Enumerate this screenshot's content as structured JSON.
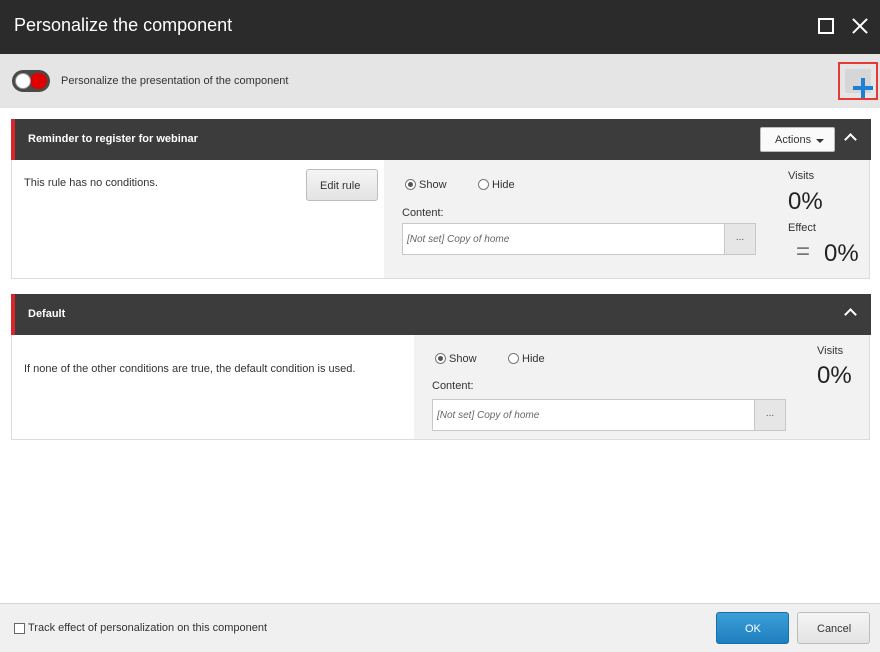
{
  "dialog": {
    "title": "Personalize the component"
  },
  "toggle_bar": {
    "label": "Personalize the presentation of the component",
    "enabled": true
  },
  "rules": [
    {
      "name": "Reminder to register for webinar",
      "actions_label": "Actions",
      "condition_text": "This rule has no conditions.",
      "edit_rule_label": "Edit rule",
      "show_label": "Show",
      "hide_label": "Hide",
      "selected": "Show",
      "content_label": "Content:",
      "content_value": "[Not set] Copy of home",
      "browse_label": "...",
      "visits_label": "Visits",
      "visits_value": "0%",
      "effect_label": "Effect",
      "effect_sign": "=",
      "effect_value": "0%"
    },
    {
      "name": "Default",
      "condition_text": "If none of the other conditions are true, the default condition is used.",
      "show_label": "Show",
      "hide_label": "Hide",
      "selected": "Show",
      "content_label": "Content:",
      "content_value": "[Not set] Copy of home",
      "browse_label": "...",
      "visits_label": "Visits",
      "visits_value": "0%"
    }
  ],
  "footer": {
    "track_label": "Track effect of personalization on this component",
    "track_checked": false,
    "ok_label": "OK",
    "cancel_label": "Cancel"
  },
  "colors": {
    "titlebar": "#2b2b2b",
    "rule_header": "#3c3c3c",
    "rule_accent": "#d9262d",
    "toggle_on": "#e00000",
    "add_icon": "#1e7fd6",
    "highlight_border": "#e53935",
    "ok_button": "#1e7fc0"
  }
}
